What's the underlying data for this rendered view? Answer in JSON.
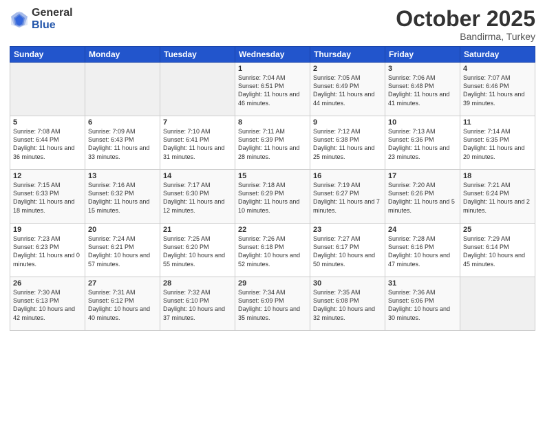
{
  "header": {
    "logo_general": "General",
    "logo_blue": "Blue",
    "month": "October 2025",
    "location": "Bandirma, Turkey"
  },
  "days_of_week": [
    "Sunday",
    "Monday",
    "Tuesday",
    "Wednesday",
    "Thursday",
    "Friday",
    "Saturday"
  ],
  "weeks": [
    [
      {
        "day": "",
        "text": ""
      },
      {
        "day": "",
        "text": ""
      },
      {
        "day": "",
        "text": ""
      },
      {
        "day": "1",
        "text": "Sunrise: 7:04 AM\nSunset: 6:51 PM\nDaylight: 11 hours and 46 minutes."
      },
      {
        "day": "2",
        "text": "Sunrise: 7:05 AM\nSunset: 6:49 PM\nDaylight: 11 hours and 44 minutes."
      },
      {
        "day": "3",
        "text": "Sunrise: 7:06 AM\nSunset: 6:48 PM\nDaylight: 11 hours and 41 minutes."
      },
      {
        "day": "4",
        "text": "Sunrise: 7:07 AM\nSunset: 6:46 PM\nDaylight: 11 hours and 39 minutes."
      }
    ],
    [
      {
        "day": "5",
        "text": "Sunrise: 7:08 AM\nSunset: 6:44 PM\nDaylight: 11 hours and 36 minutes."
      },
      {
        "day": "6",
        "text": "Sunrise: 7:09 AM\nSunset: 6:43 PM\nDaylight: 11 hours and 33 minutes."
      },
      {
        "day": "7",
        "text": "Sunrise: 7:10 AM\nSunset: 6:41 PM\nDaylight: 11 hours and 31 minutes."
      },
      {
        "day": "8",
        "text": "Sunrise: 7:11 AM\nSunset: 6:39 PM\nDaylight: 11 hours and 28 minutes."
      },
      {
        "day": "9",
        "text": "Sunrise: 7:12 AM\nSunset: 6:38 PM\nDaylight: 11 hours and 25 minutes."
      },
      {
        "day": "10",
        "text": "Sunrise: 7:13 AM\nSunset: 6:36 PM\nDaylight: 11 hours and 23 minutes."
      },
      {
        "day": "11",
        "text": "Sunrise: 7:14 AM\nSunset: 6:35 PM\nDaylight: 11 hours and 20 minutes."
      }
    ],
    [
      {
        "day": "12",
        "text": "Sunrise: 7:15 AM\nSunset: 6:33 PM\nDaylight: 11 hours and 18 minutes."
      },
      {
        "day": "13",
        "text": "Sunrise: 7:16 AM\nSunset: 6:32 PM\nDaylight: 11 hours and 15 minutes."
      },
      {
        "day": "14",
        "text": "Sunrise: 7:17 AM\nSunset: 6:30 PM\nDaylight: 11 hours and 12 minutes."
      },
      {
        "day": "15",
        "text": "Sunrise: 7:18 AM\nSunset: 6:29 PM\nDaylight: 11 hours and 10 minutes."
      },
      {
        "day": "16",
        "text": "Sunrise: 7:19 AM\nSunset: 6:27 PM\nDaylight: 11 hours and 7 minutes."
      },
      {
        "day": "17",
        "text": "Sunrise: 7:20 AM\nSunset: 6:26 PM\nDaylight: 11 hours and 5 minutes."
      },
      {
        "day": "18",
        "text": "Sunrise: 7:21 AM\nSunset: 6:24 PM\nDaylight: 11 hours and 2 minutes."
      }
    ],
    [
      {
        "day": "19",
        "text": "Sunrise: 7:23 AM\nSunset: 6:23 PM\nDaylight: 11 hours and 0 minutes."
      },
      {
        "day": "20",
        "text": "Sunrise: 7:24 AM\nSunset: 6:21 PM\nDaylight: 10 hours and 57 minutes."
      },
      {
        "day": "21",
        "text": "Sunrise: 7:25 AM\nSunset: 6:20 PM\nDaylight: 10 hours and 55 minutes."
      },
      {
        "day": "22",
        "text": "Sunrise: 7:26 AM\nSunset: 6:18 PM\nDaylight: 10 hours and 52 minutes."
      },
      {
        "day": "23",
        "text": "Sunrise: 7:27 AM\nSunset: 6:17 PM\nDaylight: 10 hours and 50 minutes."
      },
      {
        "day": "24",
        "text": "Sunrise: 7:28 AM\nSunset: 6:16 PM\nDaylight: 10 hours and 47 minutes."
      },
      {
        "day": "25",
        "text": "Sunrise: 7:29 AM\nSunset: 6:14 PM\nDaylight: 10 hours and 45 minutes."
      }
    ],
    [
      {
        "day": "26",
        "text": "Sunrise: 7:30 AM\nSunset: 6:13 PM\nDaylight: 10 hours and 42 minutes."
      },
      {
        "day": "27",
        "text": "Sunrise: 7:31 AM\nSunset: 6:12 PM\nDaylight: 10 hours and 40 minutes."
      },
      {
        "day": "28",
        "text": "Sunrise: 7:32 AM\nSunset: 6:10 PM\nDaylight: 10 hours and 37 minutes."
      },
      {
        "day": "29",
        "text": "Sunrise: 7:34 AM\nSunset: 6:09 PM\nDaylight: 10 hours and 35 minutes."
      },
      {
        "day": "30",
        "text": "Sunrise: 7:35 AM\nSunset: 6:08 PM\nDaylight: 10 hours and 32 minutes."
      },
      {
        "day": "31",
        "text": "Sunrise: 7:36 AM\nSunset: 6:06 PM\nDaylight: 10 hours and 30 minutes."
      },
      {
        "day": "",
        "text": ""
      }
    ]
  ]
}
